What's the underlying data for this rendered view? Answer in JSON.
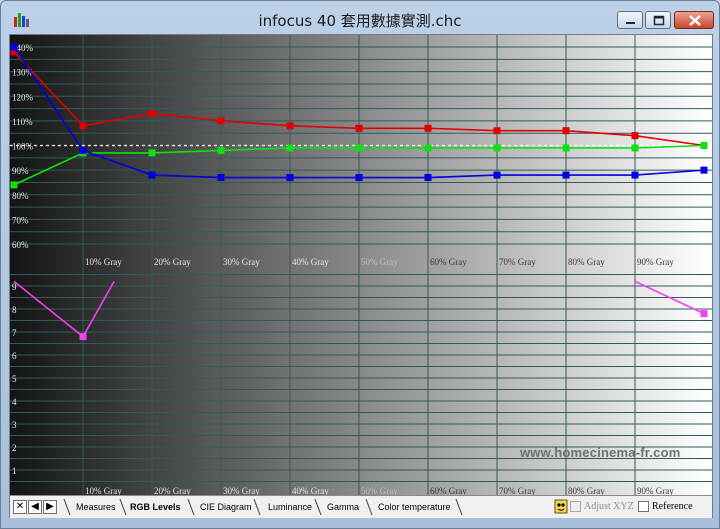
{
  "window": {
    "title": "infocus 40 套用數據實測.chc",
    "controls": [
      "minimize",
      "maximize",
      "close"
    ]
  },
  "colors": {
    "red": "#e00000",
    "green": "#10e010",
    "blue": "#0000e0",
    "magenta": "#f040f0",
    "grid": "#2e5c5c",
    "target": "#ffffff"
  },
  "watermark": "www.homecinema-fr.com",
  "chart_data": [
    {
      "type": "line",
      "title": "",
      "ylabel": "",
      "xlabel": "",
      "x_tick_labels": [
        "10% Gray",
        "20% Gray",
        "30% Gray",
        "40% Gray",
        "50% Gray",
        "60% Gray",
        "70% Gray",
        "80% Gray",
        "90% Gray"
      ],
      "y_tick_labels": [
        "60%",
        "70%",
        "80%",
        "90%",
        "100%",
        "110%",
        "120%",
        "130%",
        "140%"
      ],
      "x": [
        0,
        10,
        20,
        30,
        40,
        50,
        60,
        70,
        80,
        90,
        100
      ],
      "ylim": [
        55,
        145
      ],
      "target": 100,
      "series": [
        {
          "color": "red",
          "values": [
            138,
            108,
            113,
            110,
            108,
            107,
            107,
            106,
            106,
            104,
            100
          ]
        },
        {
          "color": "green",
          "values": [
            84,
            97,
            97,
            98,
            99,
            99,
            99,
            99,
            99,
            99,
            100
          ]
        },
        {
          "color": "blue",
          "values": [
            140,
            98,
            88,
            87,
            87,
            87,
            87,
            88,
            88,
            88,
            90
          ]
        }
      ]
    },
    {
      "type": "line",
      "title": "",
      "x_tick_labels": [
        "10% Gray",
        "20% Gray",
        "30% Gray",
        "40% Gray",
        "50% Gray",
        "60% Gray",
        "70% Gray",
        "80% Gray",
        "90% Gray"
      ],
      "y_tick_labels": [
        "1",
        "2",
        "3",
        "4",
        "5",
        "6",
        "7",
        "8",
        "9"
      ],
      "ylim": [
        0,
        10
      ],
      "series": [
        {
          "color": "magenta",
          "points": [
            [
              0,
              9.2
            ],
            [
              10,
              6.8
            ],
            [
              14.5,
              9.2
            ]
          ],
          "marker_at": [
            10,
            6.8
          ]
        },
        {
          "color": "magenta",
          "points": [
            [
              90,
              9.2
            ],
            [
              100,
              7.8
            ]
          ],
          "marker_at": [
            100,
            7.8
          ]
        }
      ]
    }
  ],
  "tabs": [
    {
      "label": "Measures",
      "active": false
    },
    {
      "label": "RGB Levels",
      "active": true
    },
    {
      "label": "CIE Diagram",
      "active": false
    },
    {
      "label": "Luminance",
      "active": false
    },
    {
      "label": "Gamma",
      "active": false
    },
    {
      "label": "Color temperature",
      "active": false
    }
  ],
  "nav_buttons": [
    "✕",
    "◀",
    "▶"
  ],
  "options": {
    "adjust_xyz": {
      "label": "Adjust XYZ",
      "checked": false,
      "enabled": false
    },
    "reference": {
      "label": "Reference",
      "checked": false,
      "enabled": true
    }
  }
}
